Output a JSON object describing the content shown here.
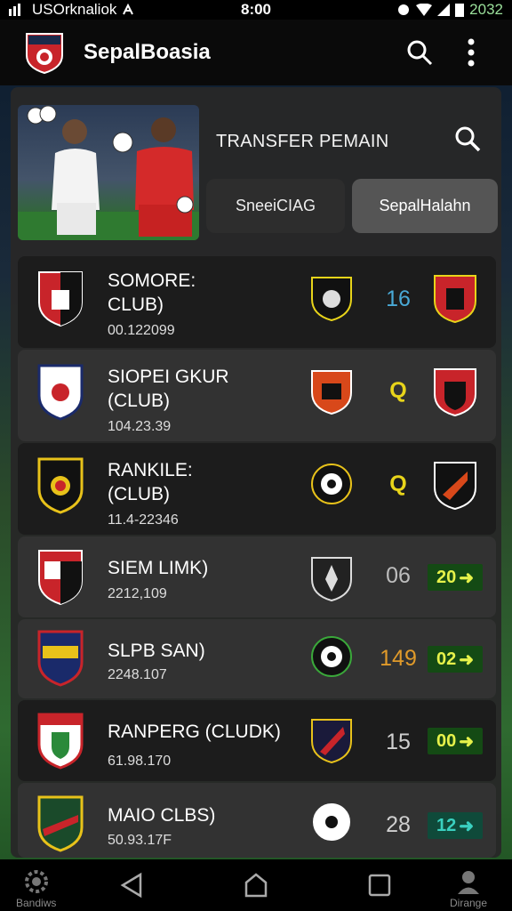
{
  "status_bar": {
    "carrier": "USOrknaliok",
    "time": "8:00",
    "battery_text": "2032"
  },
  "app_bar": {
    "title": "SepalBoasia",
    "actions": [
      "search-icon",
      "more-vert-icon"
    ]
  },
  "header": {
    "title": "TRANSFER PEMAIN",
    "tabs": [
      {
        "label": "SneeiCIAG",
        "active": false
      },
      {
        "label": "SepalHalahn",
        "active": true
      }
    ]
  },
  "transfers": [
    {
      "name_line1": "SOMORE:",
      "name_line2": "CLUB)",
      "date": "00.122099",
      "score": "16",
      "score_color": "#49a9d6",
      "right_type": "crest"
    },
    {
      "name_line1": "SIOPEI GKUR",
      "name_line2": "(CLUB)",
      "date": "104.23.39",
      "score": "Q",
      "score_color": "#e8d41a",
      "right_type": "crest"
    },
    {
      "name_line1": "RANKILE:",
      "name_line2": "(CLUB)",
      "date": "11.4-22346",
      "score": "Q",
      "score_color": "#e8d41a",
      "right_type": "crest"
    },
    {
      "name_line1": "SIEM LIMK)",
      "name_line2": "",
      "date": "2212,109",
      "score": "06",
      "score_color": "#bdbdbd",
      "right_type": "box",
      "box_value": "20"
    },
    {
      "name_line1": "SLPB SAN)",
      "name_line2": "",
      "date": "2248.107",
      "score": "149",
      "score_color": "#e09a2a",
      "right_type": "box",
      "box_value": "02"
    },
    {
      "name_line1": "RANPERG (CLUDK)",
      "name_line2": "",
      "date": "61.98.170",
      "score": "15",
      "score_color": "#cfcfcf",
      "right_type": "box",
      "box_value": "00"
    },
    {
      "name_line1": "MAIO CLBS)",
      "name_line2": "",
      "date": "50.93.17F",
      "score": "28",
      "score_color": "#cfcfcf",
      "right_type": "box",
      "box_value": "12"
    }
  ],
  "nav_bar": {
    "left_label": "Bandiws",
    "right_label": "Dirange",
    "icons": [
      "settings-icon",
      "back-icon",
      "home-icon",
      "recents-icon",
      "profile-icon"
    ]
  },
  "colors": {
    "accent_green_box": "#144a14",
    "box_text": "#e6f24a",
    "panel": "#282828"
  }
}
